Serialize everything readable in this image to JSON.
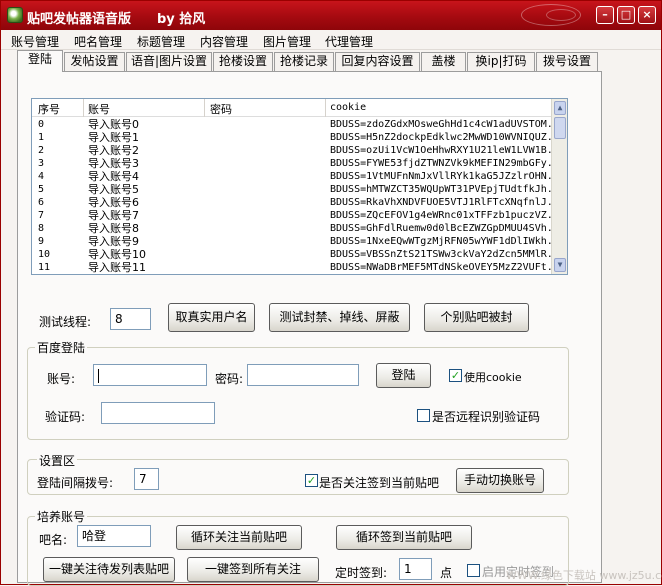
{
  "window": {
    "title": "贴吧发帖器语音版",
    "author": "by 拾风",
    "minimize_glyph": "–",
    "restore_glyph": "□",
    "close_glyph": "×"
  },
  "menu": [
    "账号管理",
    "吧名管理",
    "标题管理",
    "内容管理",
    "图片管理",
    "代理管理"
  ],
  "tabs": [
    "登陆",
    "发帖设置",
    "语音|图片设置",
    "抢楼设置",
    "抢楼记录",
    "回复内容设置",
    "盖楼",
    "换ip|打码",
    "拨号设置"
  ],
  "grid": {
    "columns": [
      "序号",
      "账号",
      "密码",
      "cookie"
    ],
    "rows": [
      {
        "idx": "0",
        "account": "导入账号0",
        "cookie": "BDUSS=zdoZGdxMOsweGhHd1c4cW1adUVSTOM..."
      },
      {
        "idx": "1",
        "account": "导入账号1",
        "cookie": "BDUSS=H5nZ2dockpEdklwc2MwWD10WVNIQUZ..."
      },
      {
        "idx": "2",
        "account": "导入账号2",
        "cookie": "BDUSS=ozUi1VcW1OeHhwRXY1U21leW1LVW1B..."
      },
      {
        "idx": "3",
        "account": "导入账号3",
        "cookie": "BDUSS=FYWE53fjdZTWNZVk9kMEFIN29mbGFy..."
      },
      {
        "idx": "4",
        "account": "导入账号4",
        "cookie": "BDUSS=1VtMUFnNmJxVllRYk1kaG5JZzlrOHN..."
      },
      {
        "idx": "5",
        "account": "导入账号5",
        "cookie": "BDUSS=hMTWZCT35WQUpWT31PVEpjTUdtfkJh..."
      },
      {
        "idx": "6",
        "account": "导入账号6",
        "cookie": "BDUSS=RkaVhXNDVFUOE5VTJ1RlFTcXNqfnlJ..."
      },
      {
        "idx": "7",
        "account": "导入账号7",
        "cookie": "BDUSS=ZQcEFOV1g4eWRnc01xTFFzb1puczVZ..."
      },
      {
        "idx": "8",
        "account": "导入账号8",
        "cookie": "BDUSS=GhFdlRuemw0d0lBcEZWZGpDMUU4SVh..."
      },
      {
        "idx": "9",
        "account": "导入账号9",
        "cookie": "BDUSS=1NxeEQwWTgzMjRFN05wYWF1dDlIWkh..."
      },
      {
        "idx": "10",
        "account": "导入账号10",
        "cookie": "BDUSS=VBSSnZtS21TSWw3ckVaY2dZcn5MMlR..."
      },
      {
        "idx": "11",
        "account": "导入账号11",
        "cookie": "BDUSS=NWaDBrMEF5MTdNSkeOVEY5MzZ2VUFt..."
      }
    ]
  },
  "threads": {
    "label": "测试线程:",
    "value": "8",
    "btn_get_username": "取真实用户名",
    "btn_test_ban": "测试封禁、掉线、屏蔽",
    "btn_individual_bar": "个别贴吧被封"
  },
  "login": {
    "group_title": "百度登陆",
    "account_label": "账号:",
    "account_value": "",
    "password_label": "密码:",
    "password_value": "",
    "login_button": "登陆",
    "use_cookie_label": "使用cookie",
    "use_cookie_checked": true,
    "captcha_label": "验证码:",
    "captcha_value": "",
    "remote_captcha_label": "是否远程识别验证码",
    "remote_captcha_checked": false
  },
  "settings": {
    "group_title": "设置区",
    "interval_label": "登陆间隔拨号:",
    "interval_value": "7",
    "follow_signin_label": "是否关注签到当前贴吧",
    "follow_signin_checked": true,
    "switch_account_button": "手动切换账号"
  },
  "cultivate": {
    "group_title": "培养账号",
    "bar_label": "吧名:",
    "bar_value": "哈登",
    "loop_follow_button": "循环关注当前贴吧",
    "loop_signin_button": "循环签到当前贴吧",
    "follow_post_button": "一键关注待发列表贴吧",
    "signin_all_button": "一键签到所有关注",
    "timed_signin_label": "定时签到:",
    "timed_signin_value": "1",
    "timed_signin_unit": "点",
    "enable_timer_label": "启用定时签到",
    "enable_timer_checked": false
  },
  "watermark": "WWW.绿色下载站 www.jz5u.com",
  "checkmark": "✓"
}
